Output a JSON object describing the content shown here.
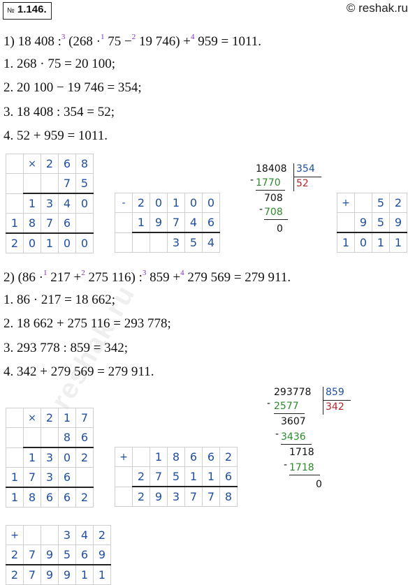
{
  "header": {
    "number_prefix": "№",
    "number": "1.146.",
    "site": "© reshak.ru"
  },
  "part1": {
    "expr": [
      "1) 18 408 :",
      "3",
      " (268 ·",
      "1",
      " 75 −",
      "2",
      " 19 746) +",
      "4",
      " 959 = 1011."
    ],
    "steps": [
      "1.  268 · 75 = 20 100;",
      "2.  20 100 − 19 746 = 354;",
      "3.  18 408 : 354 = 52;",
      "4.  52 + 959 = 1011."
    ],
    "mult_grid": [
      [
        "",
        "×",
        "2",
        "6",
        "8"
      ],
      [
        "",
        "",
        "",
        "7",
        "5"
      ],
      [
        "",
        "1",
        "3",
        "4",
        "0"
      ],
      [
        "1",
        "8",
        "7",
        "6",
        ""
      ],
      [
        "2",
        "0",
        "1",
        "0",
        "0"
      ]
    ],
    "sub_grid": [
      [
        "-",
        "2",
        "0",
        "1",
        "0",
        "0"
      ],
      [
        "",
        "1",
        "9",
        "7",
        "4",
        "6"
      ],
      [
        "",
        "",
        "",
        "3",
        "5",
        "4"
      ]
    ],
    "division": {
      "dividend": "18408",
      "divisor": "354",
      "quotient": "52",
      "sub1": "1770",
      "rem1": "708",
      "sub2": "708",
      "rem2": "0",
      "minus": "-"
    },
    "add_grid": [
      [
        "+",
        "",
        "5",
        "2"
      ],
      [
        "",
        "9",
        "5",
        "9"
      ],
      [
        "1",
        "0",
        "1",
        "1"
      ]
    ]
  },
  "part2": {
    "expr": [
      "2) (86 ·",
      "1",
      " 217 +",
      "2",
      " 275 116) :",
      "3",
      " 859 +",
      "4",
      " 279 569 = 279 911."
    ],
    "steps": [
      "1.  86 · 217 = 18 662;",
      "2.  18 662 + 275 116 = 293 778;",
      "3.  293 778 : 859 = 342;",
      "4.  342 + 279 569 = 279 911."
    ],
    "mult_grid": [
      [
        "",
        "×",
        "2",
        "1",
        "7"
      ],
      [
        "",
        "",
        "",
        "8",
        "6"
      ],
      [
        "",
        "1",
        "3",
        "0",
        "2"
      ],
      [
        "1",
        "7",
        "3",
        "6",
        ""
      ],
      [
        "1",
        "8",
        "6",
        "6",
        "2"
      ]
    ],
    "add_grid": [
      [
        "+",
        "",
        "1",
        "8",
        "6",
        "6",
        "2"
      ],
      [
        "",
        "2",
        "7",
        "5",
        "1",
        "1",
        "6"
      ],
      [
        "",
        "2",
        "9",
        "3",
        "7",
        "7",
        "8"
      ]
    ],
    "division": {
      "dividend": "293778",
      "divisor": "859",
      "quotient": "342",
      "sub1": "2577",
      "rem1": "3607",
      "sub2": "3436",
      "rem2": "1718",
      "sub3": "1718",
      "rem3": "0",
      "minus": "-"
    },
    "add_grid2": [
      [
        "+",
        "",
        "",
        "3",
        "4",
        "2"
      ],
      [
        "2",
        "7",
        "9",
        "5",
        "6",
        "9"
      ],
      [
        "2",
        "7",
        "9",
        "9",
        "1",
        "1"
      ]
    ]
  },
  "watermark": "reshak.ru"
}
